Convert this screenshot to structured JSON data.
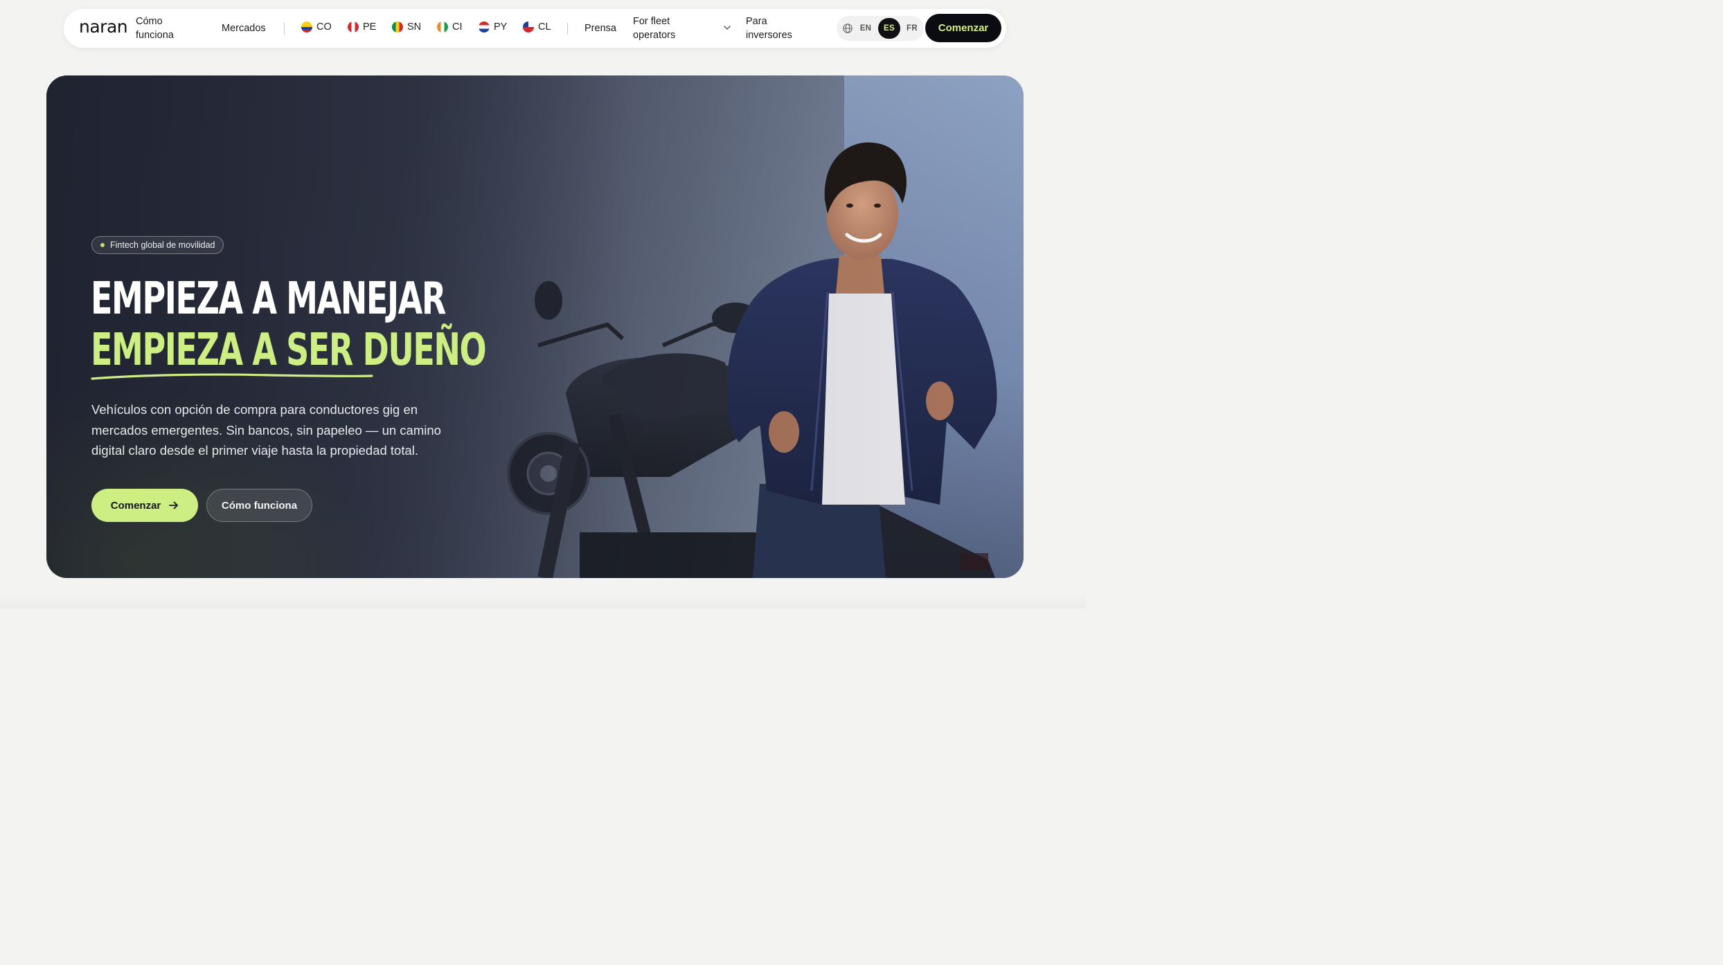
{
  "nav": {
    "logo": "naran",
    "how_it_works": "Cómo funciona",
    "markets": "Mercados",
    "market_items": [
      {
        "code": "CO",
        "flag": "colombia-flag"
      },
      {
        "code": "PE",
        "flag": "peru-flag"
      },
      {
        "code": "SN",
        "flag": "senegal-flag"
      },
      {
        "code": "CI",
        "flag": "cote-divoire-flag"
      },
      {
        "code": "PY",
        "flag": "paraguay-flag"
      },
      {
        "code": "CL",
        "flag": "chile-flag"
      }
    ],
    "press": "Prensa",
    "fleet": "For fleet operators",
    "investors": "Para inversores",
    "languages": {
      "items": [
        "EN",
        "ES",
        "FR"
      ],
      "active": "ES"
    },
    "cta": "Comenzar"
  },
  "hero": {
    "badge": "Fintech global de movilidad",
    "headline_line1": "EMPIEZA A MANEJAR",
    "headline_line2": "EMPIEZA A SER DUEÑO",
    "lead": "Vehículos con opción de compra para conductores gig en mercados emergentes. Sin bancos, sin papeleo — un camino digital claro desde el primer viaje hasta la propiedad total.",
    "primary_cta": "Comenzar",
    "secondary_cta": "Cómo funciona"
  },
  "colors": {
    "accent_lime": "#cdee82",
    "dark": "#0b0b12",
    "hero_base": "#3a4052"
  }
}
